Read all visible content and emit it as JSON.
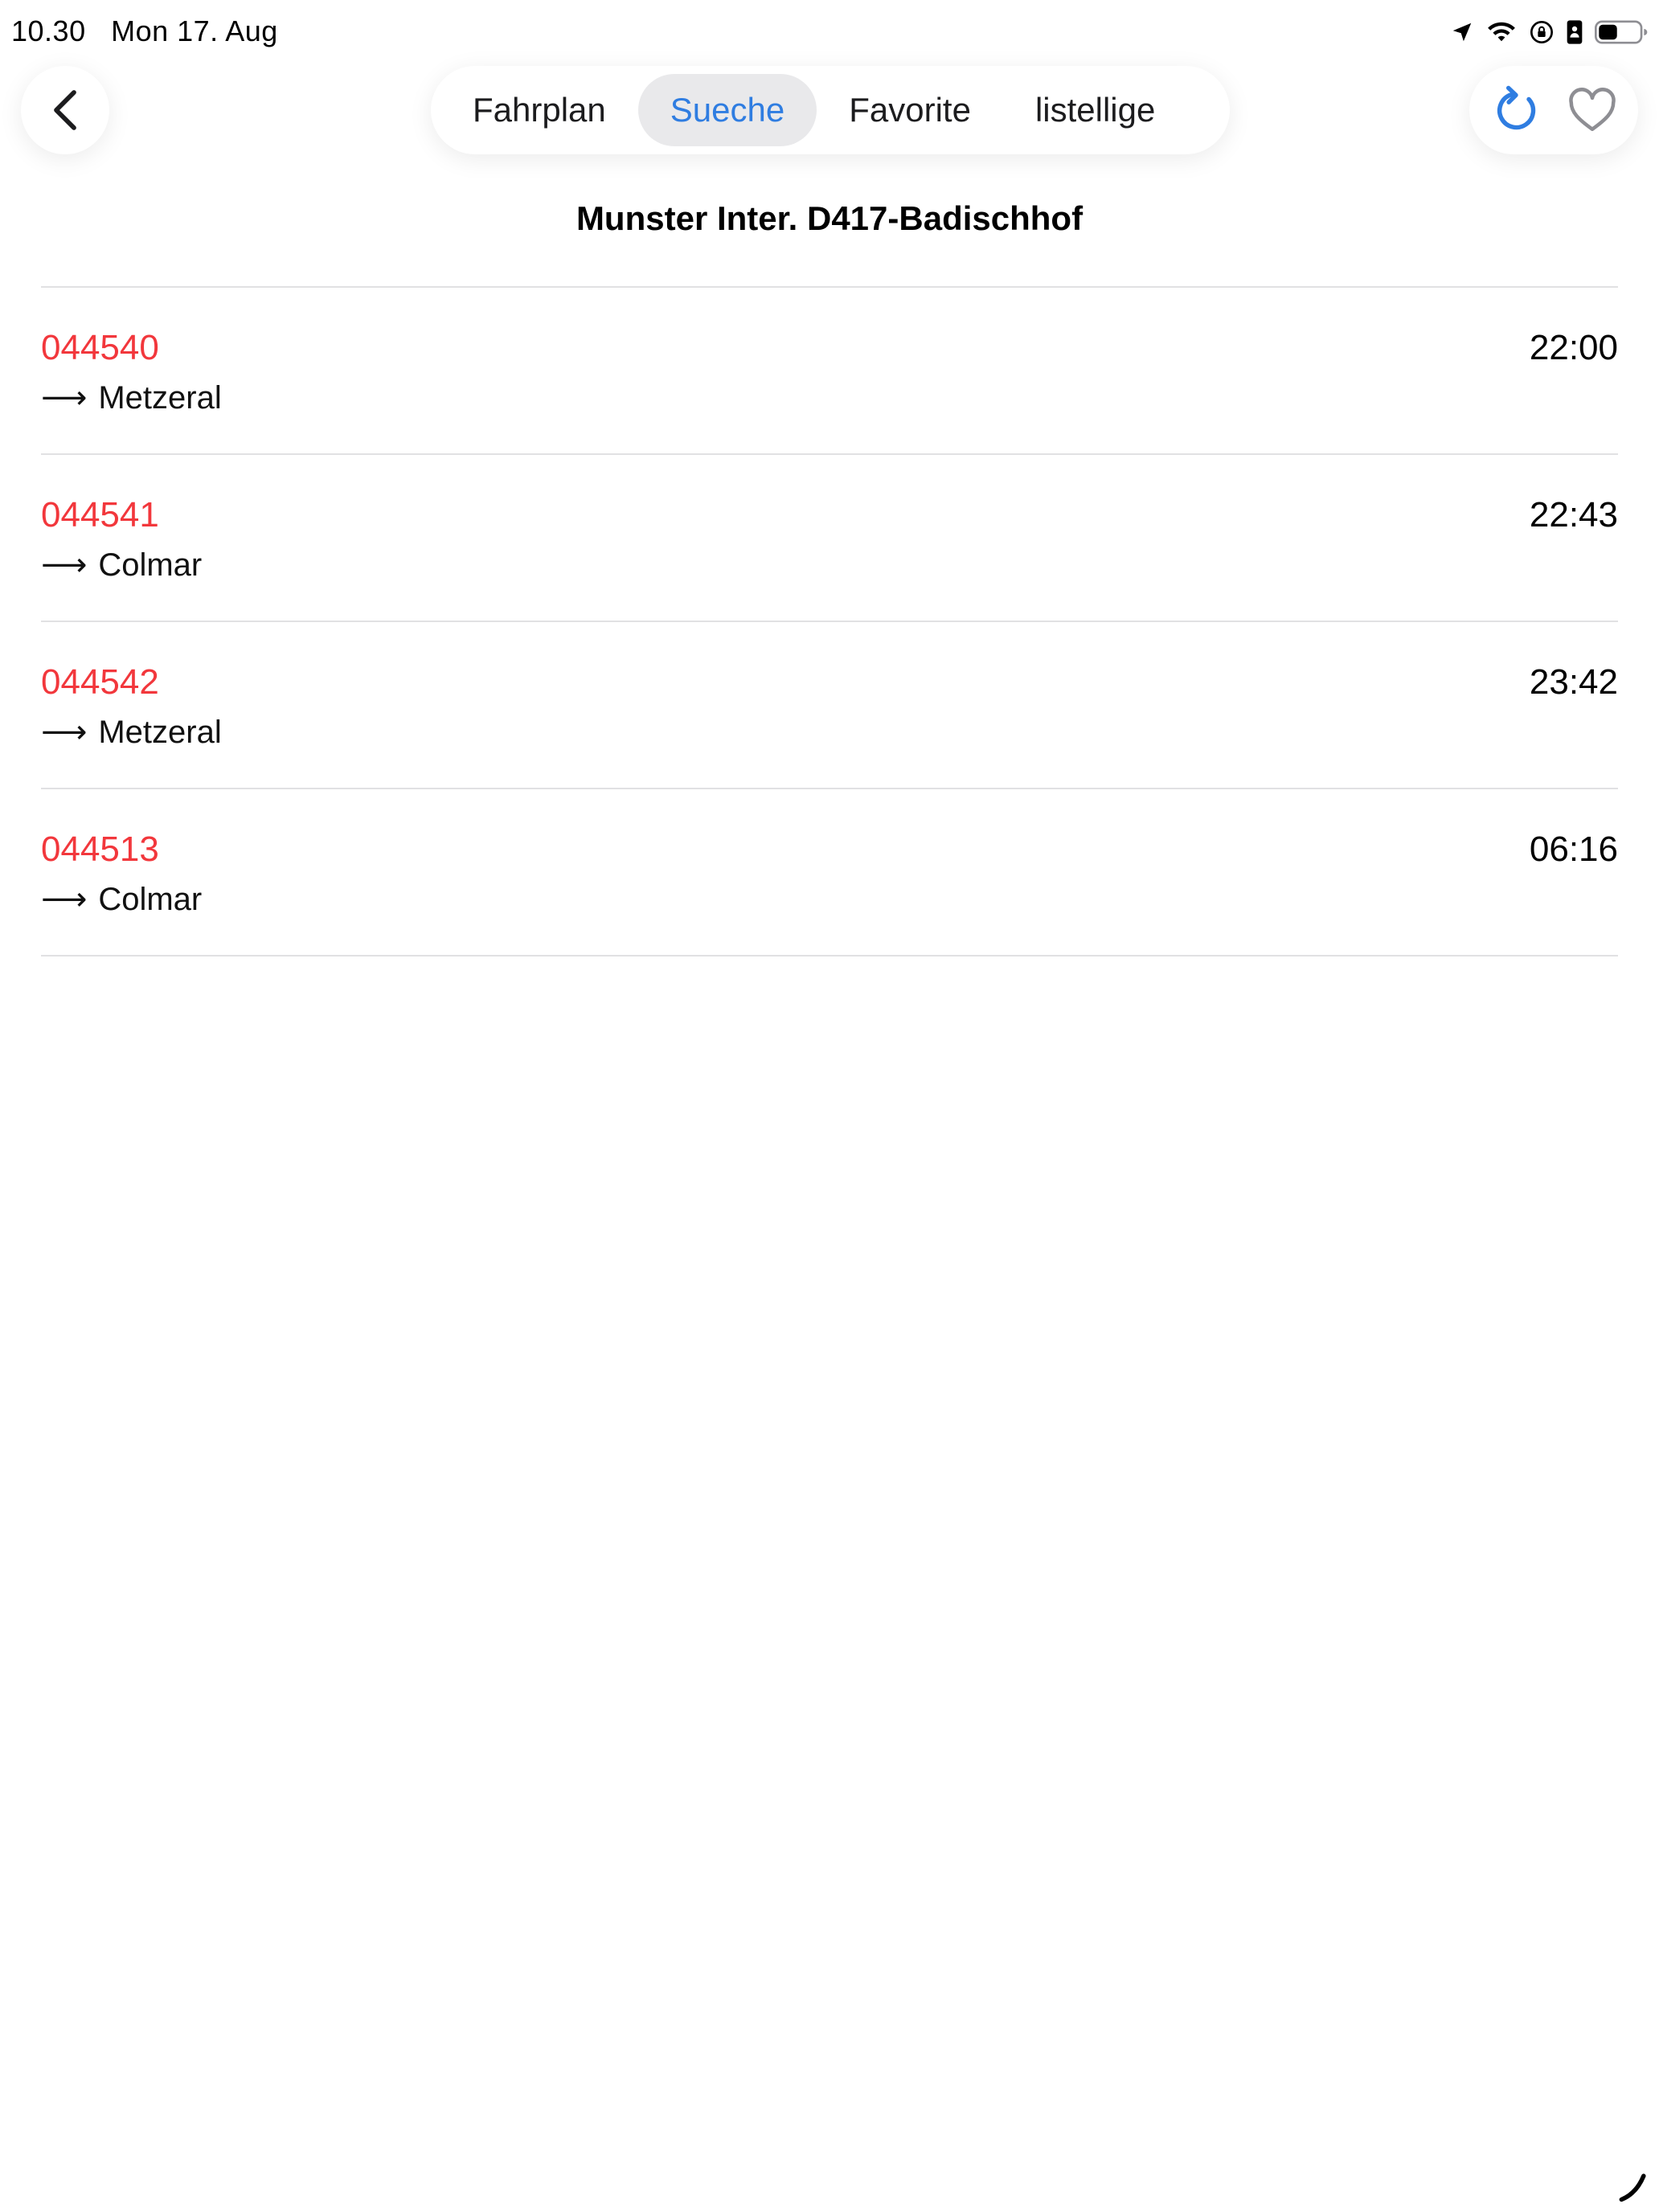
{
  "status_bar": {
    "time": "10.30",
    "date": "Mon 17. Aug",
    "icons": [
      "location-arrow-icon",
      "wifi-icon",
      "rotation-lock-icon",
      "portrait-lock-icon",
      "battery-icon"
    ]
  },
  "nav": {
    "back_icon": "chevron-left-icon",
    "tabs": [
      {
        "label": "Fahrplan",
        "active": false
      },
      {
        "label": "Sueche",
        "active": true
      },
      {
        "label": "Favorite",
        "active": false
      },
      {
        "label": "listellige",
        "active": false
      }
    ],
    "refresh_icon": "refresh-icon",
    "favorite_icon": "heart-icon"
  },
  "title": "Munster Inter. D417-Badischhof",
  "departures": [
    {
      "train": "044540",
      "destination": "Metzeral",
      "time": "22:00"
    },
    {
      "train": "044541",
      "destination": "Colmar",
      "time": "22:43"
    },
    {
      "train": "044542",
      "destination": "Metzeral",
      "time": "23:42"
    },
    {
      "train": "044513",
      "destination": "Colmar",
      "time": "06:16"
    }
  ],
  "arrow_glyph": "⟶",
  "colors": {
    "accent": "#2f7de1",
    "train_number": "#f2373c",
    "divider": "#e1e1e3",
    "active_tab_bg": "#e9e9eb"
  }
}
